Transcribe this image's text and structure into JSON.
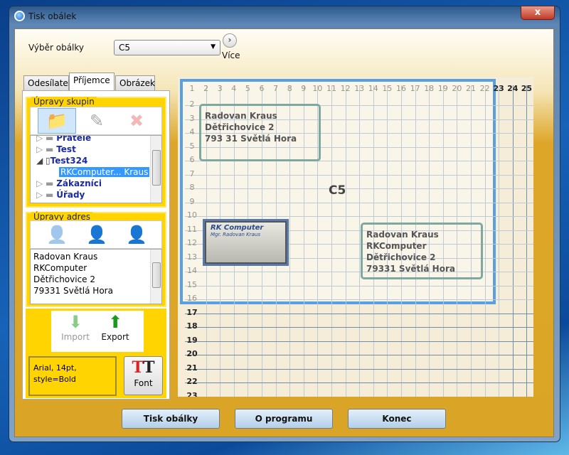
{
  "window": {
    "title": "Tisk obálek",
    "close_label": "x"
  },
  "envelope_select": {
    "label": "Výběr obálky",
    "value": "C5",
    "more_label": "Více"
  },
  "tabs": [
    {
      "label": "Odesílatel"
    },
    {
      "label": "Příjemce",
      "active": true
    },
    {
      "label": "Obrázek"
    }
  ],
  "groups_section": {
    "title": "Úpravy skupin",
    "tree": [
      "Přátelé",
      "Test",
      "Test324",
      "RKComputer... Kraus",
      "Zákazníci",
      "Úřady"
    ]
  },
  "address_section": {
    "title": "Úpravy adres",
    "lines": [
      "Radovan  Kraus",
      "RKComputer",
      "Dětřichovice  2",
      "79331  Světlá Hora"
    ]
  },
  "import_label": "Import",
  "export_label": "Export",
  "font_info": {
    "line1": "Arial, 14pt,",
    "line2": "style=Bold"
  },
  "font_button": "Font",
  "preview": {
    "format": "C5",
    "sender": [
      "Radovan  Kraus",
      "Dětřichovice 2",
      "793 31 Světlá Hora"
    ],
    "recipient": [
      "Radovan  Kraus",
      "RKComputer",
      "Dětřichovice  2",
      "79331  Světlá Hora"
    ],
    "logo_text": [
      "RK Computer",
      "Mgr. Radovan Kraus"
    ],
    "columns": 25,
    "rows": 22,
    "envelope_columns": 22,
    "envelope_rows": 16
  },
  "buttons": {
    "print": "Tisk obálky",
    "about": "O programu",
    "exit": "Konec"
  }
}
